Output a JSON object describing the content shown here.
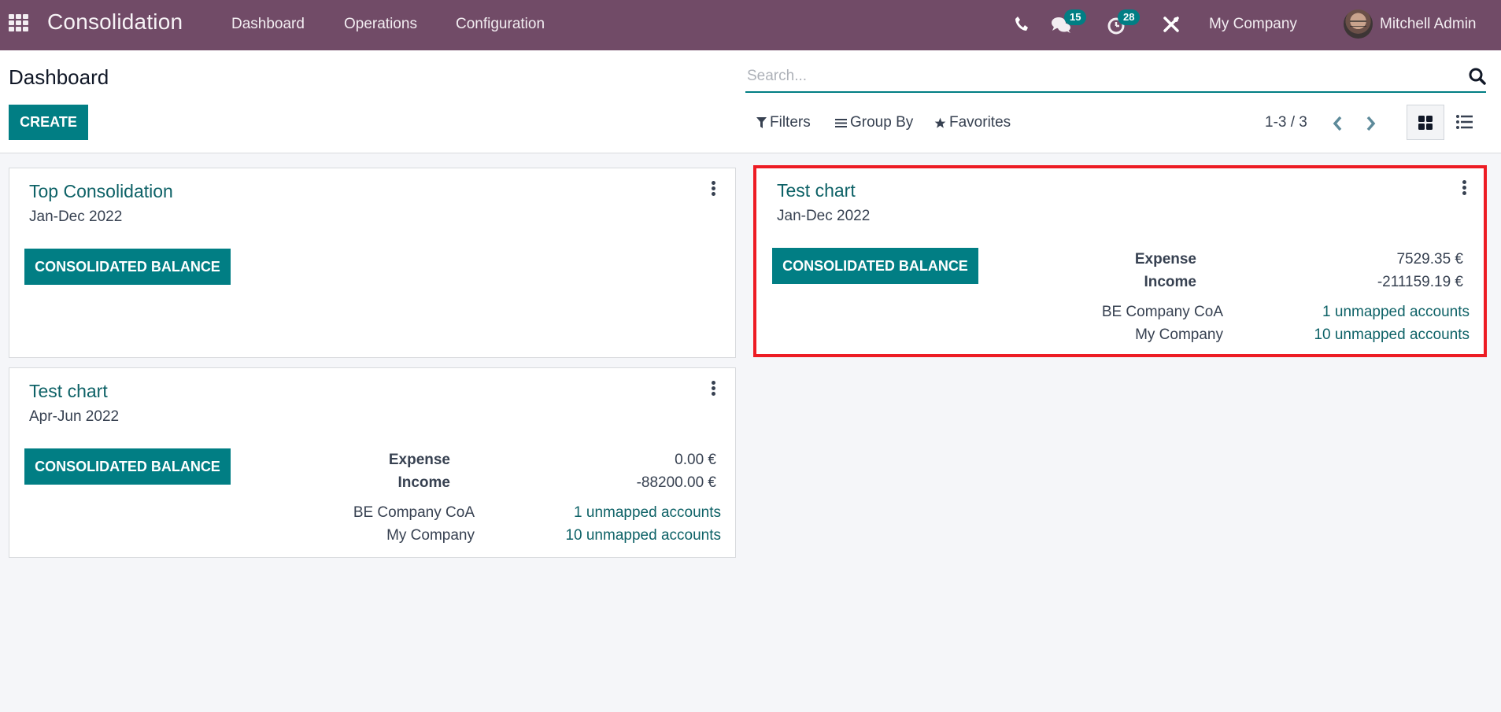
{
  "navbar": {
    "app_name": "Consolidation",
    "menu": [
      "Dashboard",
      "Operations",
      "Configuration"
    ],
    "messages_badge": "15",
    "activities_badge": "28",
    "company": "My Company",
    "user": "Mitchell Admin",
    "icons": [
      "apps-grid-icon",
      "phone-icon",
      "chat-icon",
      "clock-icon",
      "tools-icon"
    ]
  },
  "control_panel": {
    "title": "Dashboard",
    "create_label": "CREATE",
    "search_placeholder": "Search...",
    "filters_label": "Filters",
    "groupby_label": "Group By",
    "favorites_label": "Favorites",
    "pager": "1-3 / 3",
    "active_view": "kanban"
  },
  "cards": [
    {
      "title": "Top Consolidation",
      "period": "Jan-Dec 2022",
      "button": "CONSOLIDATED BALANCE",
      "highlighted": false
    },
    {
      "title": "Test chart",
      "period": "Apr-Jun 2022",
      "button": "CONSOLIDATED BALANCE",
      "highlighted": false,
      "stats": [
        {
          "label": "Expense",
          "value": "0.00 €"
        },
        {
          "label": "Income",
          "value": "-88200.00 €"
        }
      ],
      "companies": [
        {
          "name": "BE Company CoA",
          "link": "1 unmapped accounts"
        },
        {
          "name": "My Company",
          "link": "10 unmapped accounts"
        }
      ]
    },
    {
      "title": "Test chart",
      "period": "Jan-Dec 2022",
      "button": "CONSOLIDATED BALANCE",
      "highlighted": true,
      "stats": [
        {
          "label": "Expense",
          "value": "7529.35 €"
        },
        {
          "label": "Income",
          "value": "-211159.19 €"
        }
      ],
      "companies": [
        {
          "name": "BE Company CoA",
          "link": "1 unmapped accounts"
        },
        {
          "name": "My Company",
          "link": "10 unmapped accounts"
        }
      ]
    }
  ],
  "colors": {
    "navbar": "#714B67",
    "primary": "#017e84",
    "link": "#0e6267",
    "highlight": "#ed1c24"
  }
}
